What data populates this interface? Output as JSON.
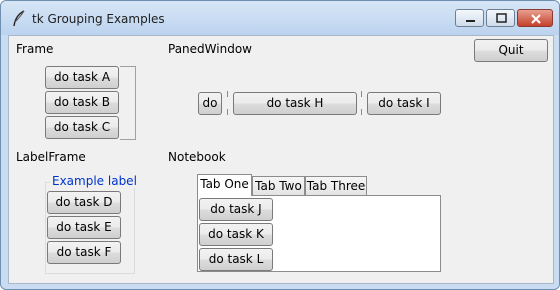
{
  "window": {
    "title": "tk Grouping Examples"
  },
  "frame": {
    "label": "Frame",
    "buttons": [
      "do task A",
      "do task B",
      "do task C"
    ]
  },
  "paned": {
    "label": "PanedWindow",
    "buttons": [
      "do",
      "do task H",
      "do task I"
    ]
  },
  "labelframe": {
    "label": "LabelFrame",
    "caption": "Example label",
    "buttons": [
      "do task D",
      "do task E",
      "do task F"
    ]
  },
  "notebook": {
    "label": "Notebook",
    "tabs": [
      "Tab One",
      "Tab Two",
      "Tab Three"
    ],
    "selected_tab": "Tab One",
    "buttons": [
      "do task J",
      "do task K",
      "do task L"
    ]
  },
  "quit": {
    "label": "Quit"
  },
  "colors": {
    "caption": "#0033cc",
    "titlebar": "#c9dcf2"
  }
}
